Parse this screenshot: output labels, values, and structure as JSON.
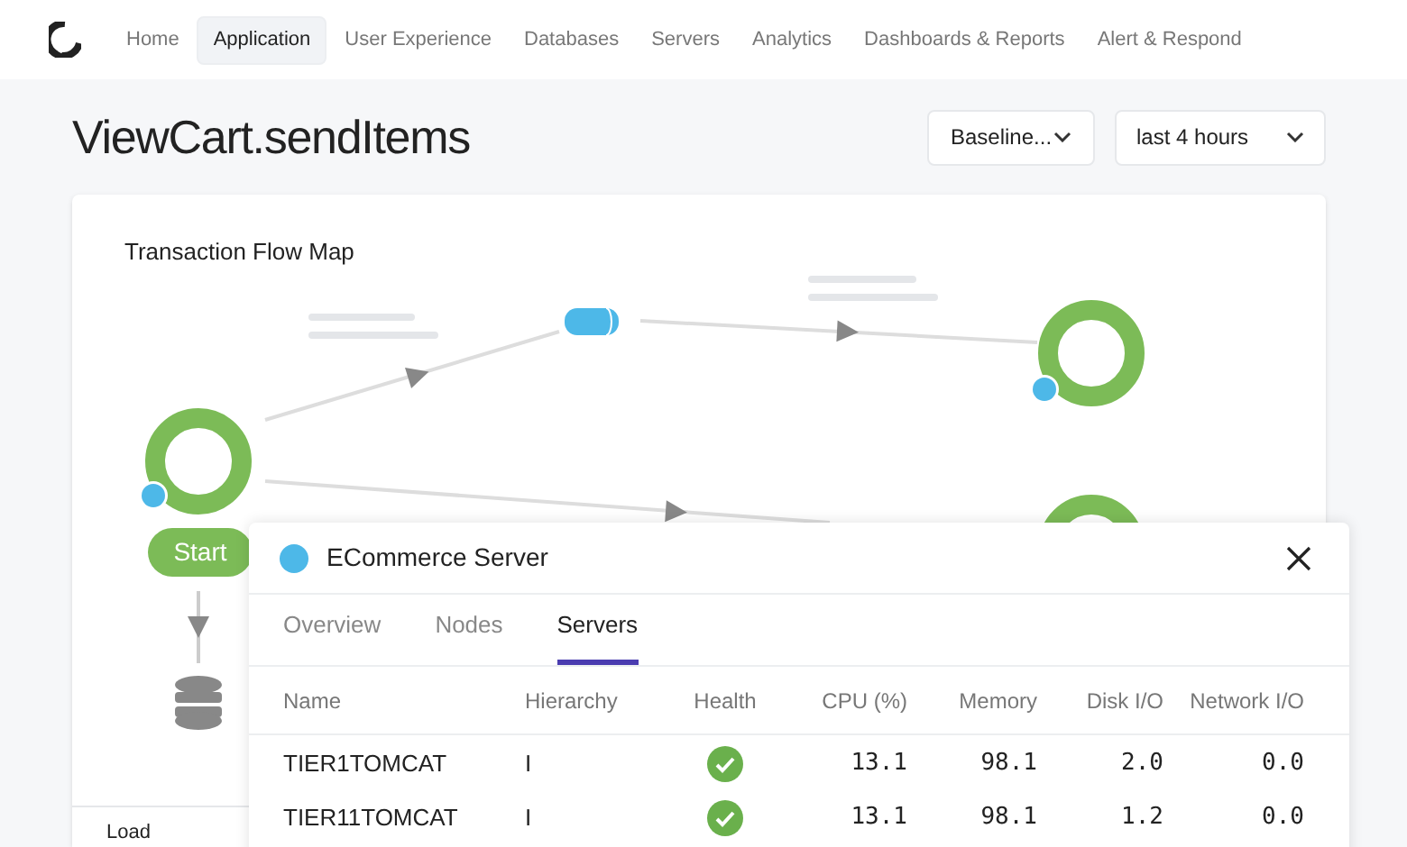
{
  "nav": {
    "items": [
      {
        "label": "Home",
        "selected": false
      },
      {
        "label": "Application",
        "selected": true
      },
      {
        "label": "User Experience",
        "selected": false
      },
      {
        "label": "Databases",
        "selected": false
      },
      {
        "label": "Servers",
        "selected": false
      },
      {
        "label": "Analytics",
        "selected": false
      },
      {
        "label": "Dashboards & Reports",
        "selected": false
      },
      {
        "label": "Alert & Respond",
        "selected": false
      }
    ]
  },
  "page": {
    "title": "ViewCart.sendItems",
    "baseline_select": "Baseline...",
    "time_select": "last 4 hours"
  },
  "flow_map": {
    "title": "Transaction Flow Map",
    "start_label": "Start",
    "side_label": "Load"
  },
  "panel": {
    "title": "ECommerce Server",
    "color": "#4db8e8",
    "tabs": [
      {
        "label": "Overview",
        "selected": false
      },
      {
        "label": "Nodes",
        "selected": false
      },
      {
        "label": "Servers",
        "selected": true
      }
    ],
    "columns": [
      "Name",
      "Hierarchy",
      "Health",
      "CPU (%)",
      "Memory",
      "Disk I/O",
      "Network I/O"
    ],
    "rows": [
      {
        "name": "TIER1TOMCAT",
        "hierarchy": "I",
        "healthy": true,
        "cpu": "13.1",
        "memory": "98.1",
        "disk": "2.0",
        "network": "0.0"
      },
      {
        "name": "TIER11TOMCAT",
        "hierarchy": "I",
        "healthy": true,
        "cpu": "13.1",
        "memory": "98.1",
        "disk": "1.2",
        "network": "0.0"
      }
    ]
  }
}
